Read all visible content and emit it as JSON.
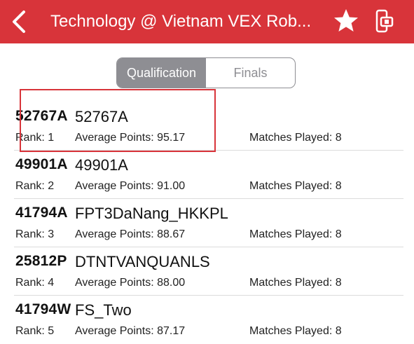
{
  "header": {
    "title": "Technology @ Vietnam VEX Rob...",
    "icons": [
      "back-icon",
      "star-icon",
      "device-icon"
    ],
    "background_color": "#d8343a"
  },
  "segments": {
    "active": "Qualification",
    "items": [
      {
        "label": "Qualification"
      },
      {
        "label": "Finals"
      }
    ]
  },
  "rankings": [
    {
      "team": "52767A",
      "name": "52767A",
      "rank": "Rank: 1",
      "avg": "Average Points: 95.17",
      "matches": "Matches Played: 8"
    },
    {
      "team": "49901A",
      "name": "49901A",
      "rank": "Rank: 2",
      "avg": "Average Points: 91.00",
      "matches": "Matches Played: 8"
    },
    {
      "team": "41794A",
      "name": "FPT3DaNang_HKKPL",
      "rank": "Rank: 3",
      "avg": "Average Points: 88.67",
      "matches": "Matches Played: 8"
    },
    {
      "team": "25812P",
      "name": "DTNTVANQUANLS",
      "rank": "Rank: 4",
      "avg": "Average Points: 88.00",
      "matches": "Matches Played: 8"
    },
    {
      "team": "41794W",
      "name": "FS_Two",
      "rank": "Rank: 5",
      "avg": "Average Points: 87.17",
      "matches": "Matches Played: 8"
    }
  ],
  "annotation": {
    "highlight_color": "#d8343a"
  }
}
